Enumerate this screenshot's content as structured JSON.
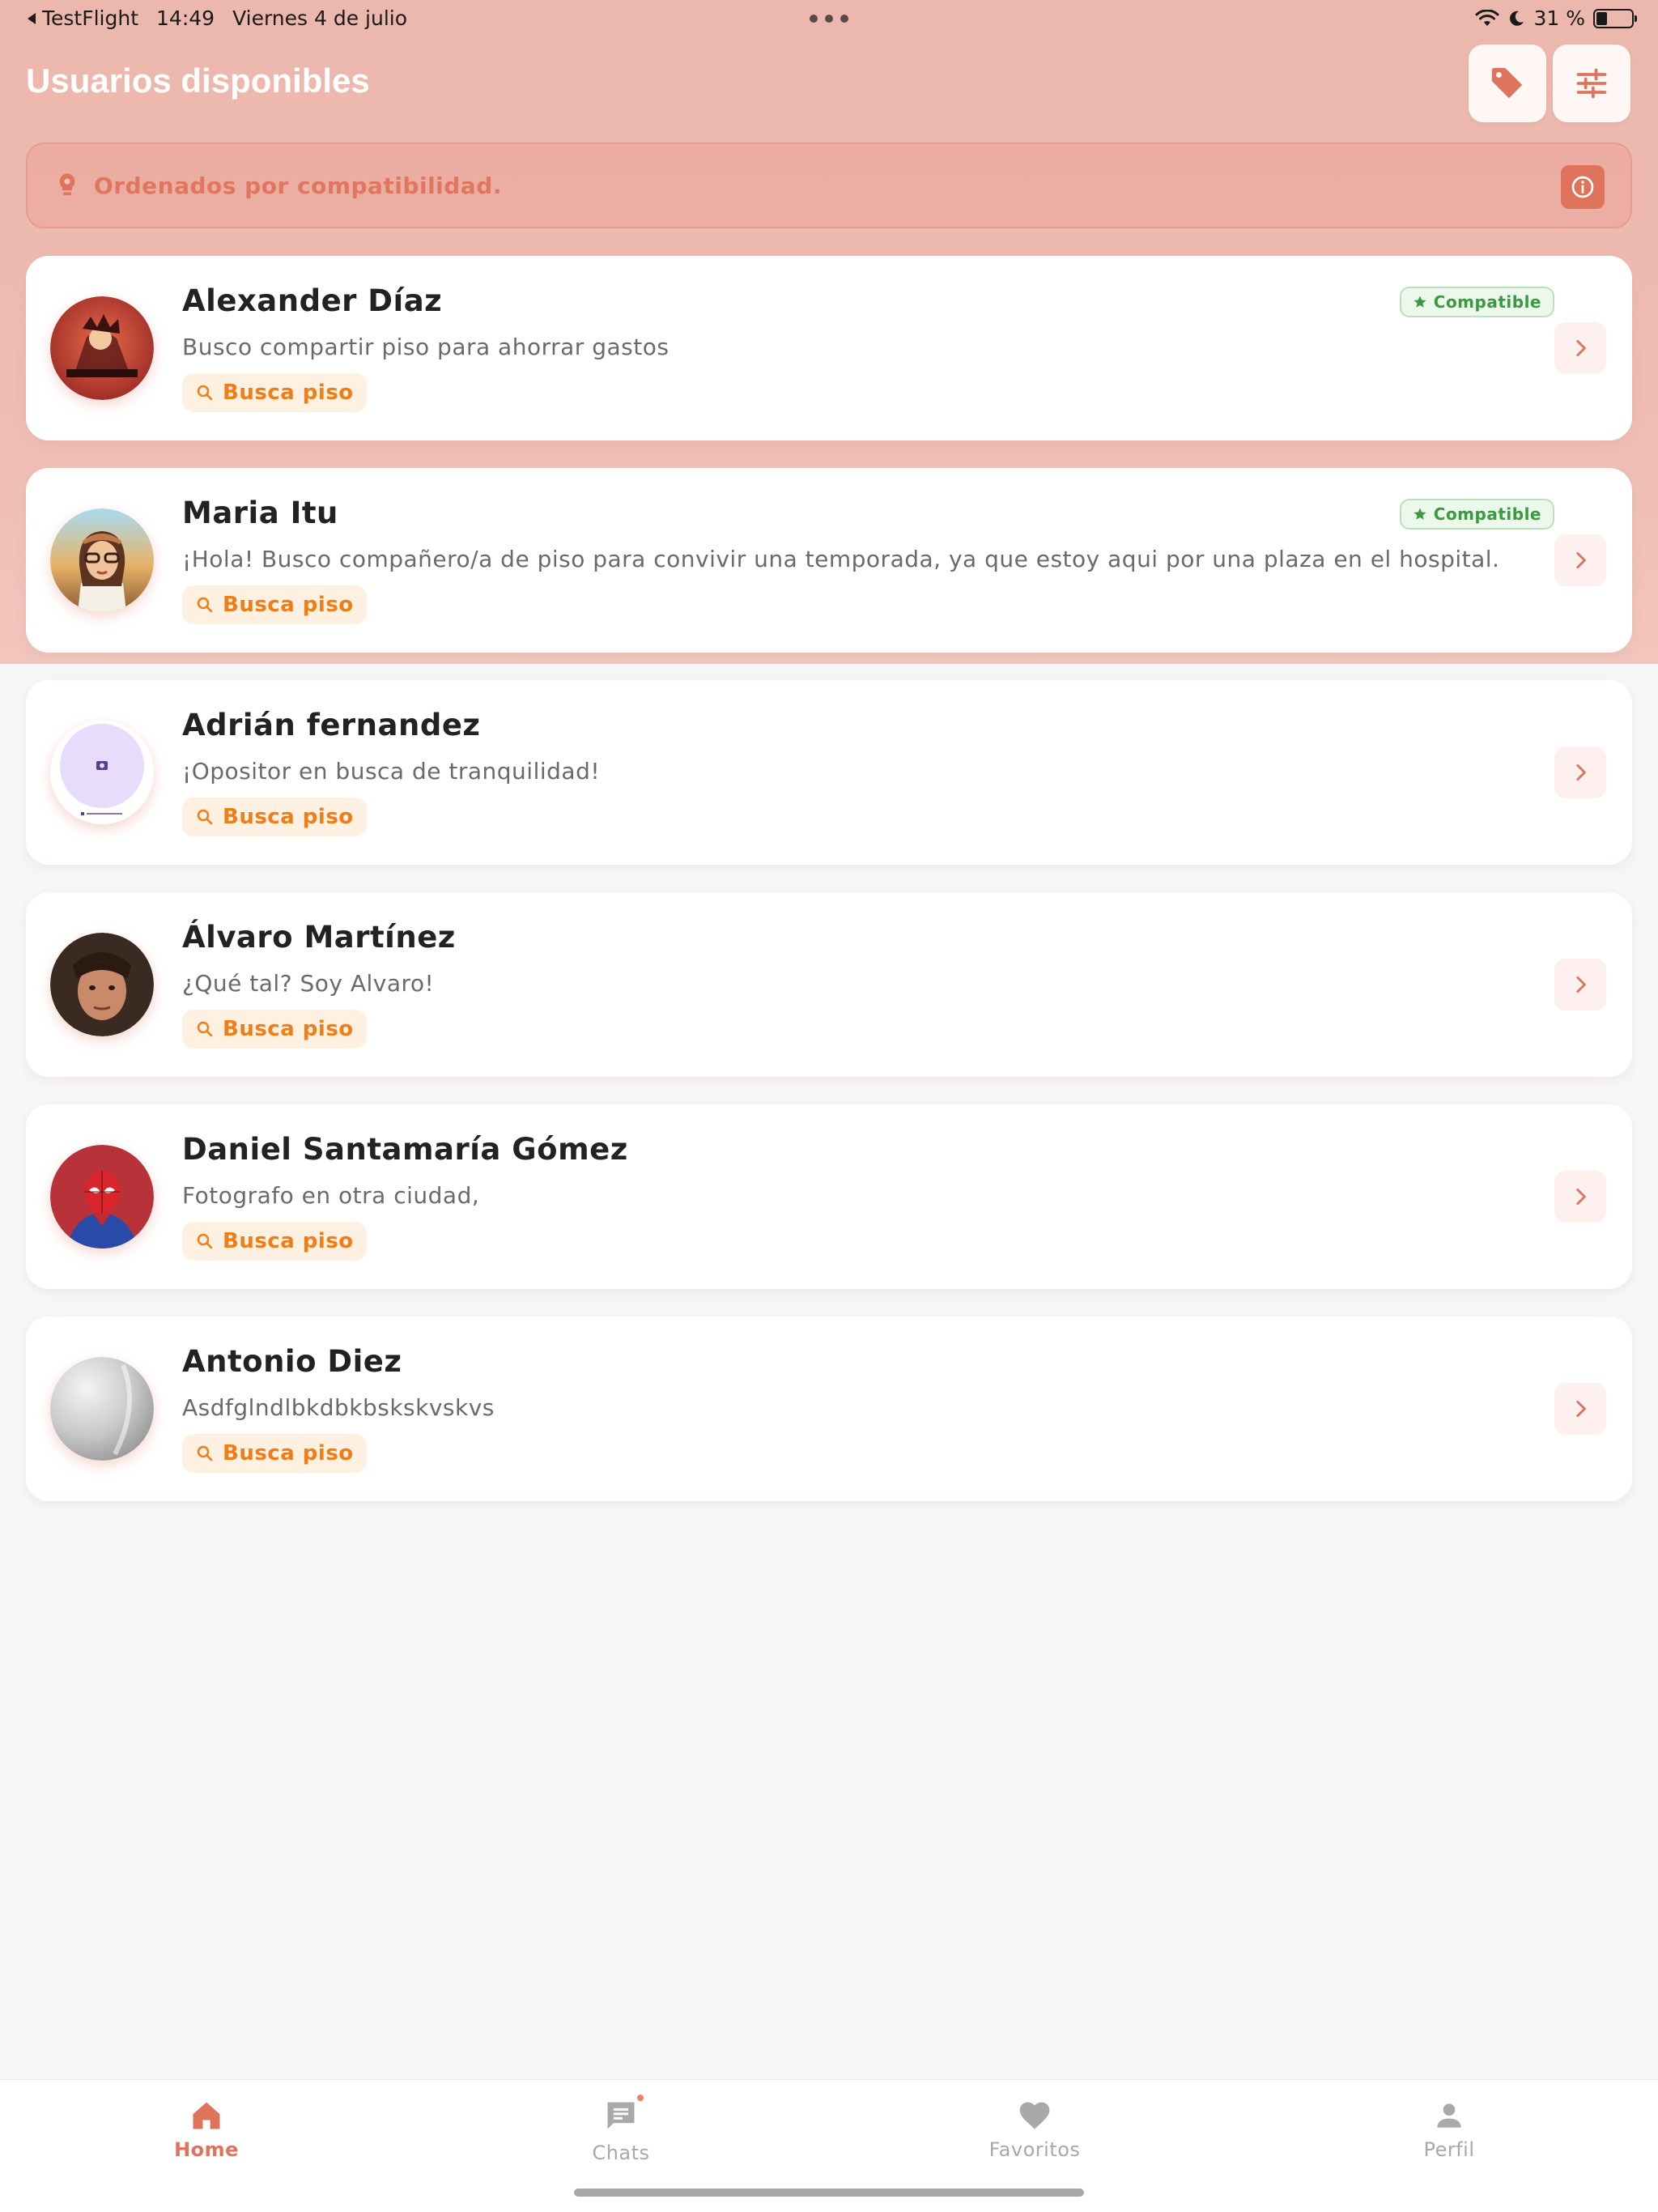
{
  "status_bar": {
    "back_app": "TestFlight",
    "time": "14:49",
    "date": "Viernes 4 de julio",
    "battery": "31 %",
    "battery_level": 0.31
  },
  "header": {
    "title": "Usuarios disponibles",
    "tag_icon": "tag-icon",
    "filter_icon": "sliders-icon"
  },
  "banner": {
    "text": "Ordenados por compatibilidad.",
    "icon": "lightbulb-icon",
    "info_icon": "info-icon"
  },
  "users": [
    {
      "name": "Alexander Díaz",
      "description": "Busco compartir piso para ahorrar gastos",
      "tag": "Busca piso",
      "compatible": "Compatible",
      "avatar": "avatar-illustration-red"
    },
    {
      "name": "Maria Itu",
      "description": "¡Hola! Busco compañero/a de piso para convivir una temporada, ya que estoy aqui por una plaza en el hospital.",
      "tag": "Busca piso",
      "compatible": "Compatible",
      "avatar": "avatar-cartoon-woman"
    },
    {
      "name": "Adrián fernandez",
      "description": "¡Opositor en busca de tranquilidad!",
      "tag": "Busca piso",
      "compatible": "",
      "avatar": "avatar-placeholder-camera"
    },
    {
      "name": "Álvaro Martínez",
      "description": "¿Qué tal? Soy Alvaro!",
      "tag": "Busca piso",
      "compatible": "",
      "avatar": "avatar-photo-man"
    },
    {
      "name": "Daniel Santamaría Gómez",
      "description": "Fotografo en otra ciudad,",
      "tag": "Busca piso",
      "compatible": "",
      "avatar": "avatar-spiderman"
    },
    {
      "name": "Antonio Diez",
      "description": "Asdfglndlbkdbkbskskvskvs",
      "tag": "Busca piso",
      "compatible": "",
      "avatar": "avatar-grey"
    }
  ],
  "nav": {
    "home": "Home",
    "chats": "Chats",
    "favoritos": "Favoritos",
    "perfil": "Perfil",
    "active": "Home"
  },
  "colors": {
    "accent": "#e0735c",
    "header_bg": "#ecb7ad",
    "pill_bg": "#fff1e2",
    "pill_text": "#ef7d18",
    "compat_text": "#3a9a3e"
  }
}
